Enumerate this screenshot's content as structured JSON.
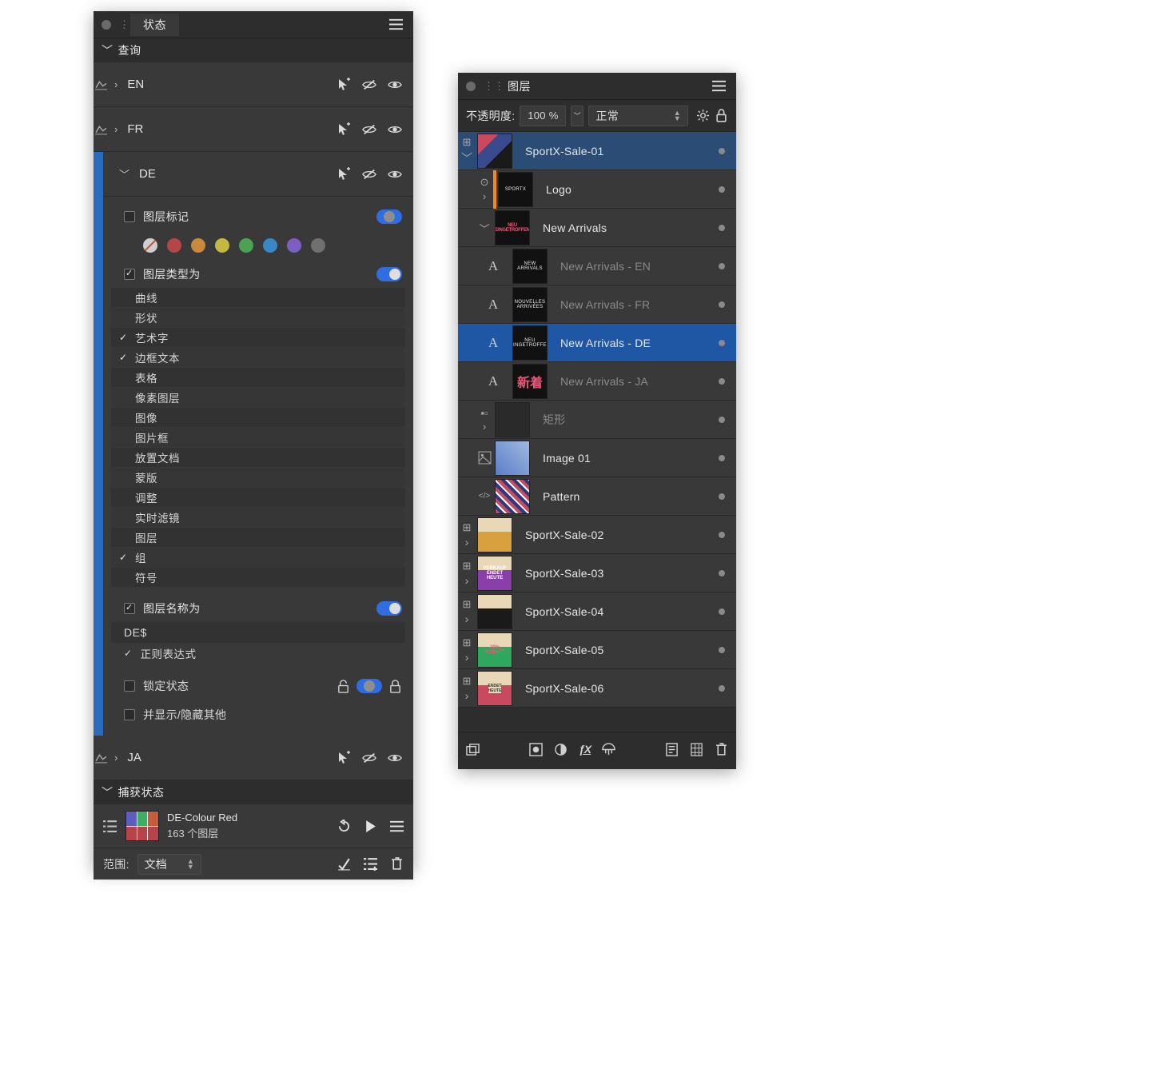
{
  "states": {
    "title": "状态",
    "query_label": "查询",
    "rows": [
      {
        "name": "EN",
        "expanded": false
      },
      {
        "name": "FR",
        "expanded": false
      },
      {
        "name": "DE",
        "expanded": true
      },
      {
        "name": "JA",
        "expanded": false
      }
    ],
    "de": {
      "layer_tag_label": "图层标记",
      "swatches": [
        "#b44646",
        "#c78a3c",
        "#c4b83e",
        "#4aa252",
        "#3a88c3",
        "#7a60c3",
        "#707070"
      ],
      "layer_type_label": "图层类型为",
      "types": [
        {
          "label": "曲线",
          "checked": false
        },
        {
          "label": "形状",
          "checked": false
        },
        {
          "label": "艺术字",
          "checked": true
        },
        {
          "label": "边框文本",
          "checked": true
        },
        {
          "label": "表格",
          "checked": false
        },
        {
          "label": "像素图层",
          "checked": false
        },
        {
          "label": "图像",
          "checked": false
        },
        {
          "label": "图片框",
          "checked": false
        },
        {
          "label": "放置文档",
          "checked": false
        },
        {
          "label": "蒙版",
          "checked": false
        },
        {
          "label": "调整",
          "checked": false
        },
        {
          "label": "实时滤镜",
          "checked": false
        },
        {
          "label": "图层",
          "checked": false
        },
        {
          "label": "组",
          "checked": true
        },
        {
          "label": "符号",
          "checked": false
        }
      ],
      "layer_name_label": "图层名称为",
      "name_value": "DE$",
      "regex_label": "正则表达式",
      "regex_checked": true,
      "lock_label": "锁定状态",
      "hide_others_label": "并显示/隐藏其他"
    },
    "captured_label": "捕获状态",
    "captured": {
      "name": "DE-Colour Red",
      "count": "163 个图层"
    },
    "footer": {
      "label": "范围:",
      "value": "文档"
    }
  },
  "layers": {
    "title": "图层",
    "opacity_label": "不透明度:",
    "opacity_value": "100 %",
    "blend_mode": "正常",
    "items": [
      {
        "kind": "artboard",
        "name": "SportX-Sale-01",
        "expanded": true,
        "sel": true,
        "thumb": "hero",
        "depth": 0
      },
      {
        "kind": "group",
        "name": "Logo",
        "depth": 1,
        "orange": true,
        "thumb_text": "SPORTX"
      },
      {
        "kind": "group",
        "name": "New Arrivals",
        "depth": 1,
        "expanded": true,
        "thumb_text": "NEU EINGETROFFEN",
        "thumbcolor": "#e85a7a"
      },
      {
        "kind": "text",
        "name": "New Arrivals - EN",
        "depth": 2,
        "thumb_text": "NEW ARRIVALS",
        "dim": true
      },
      {
        "kind": "text",
        "name": "New Arrivals - FR",
        "depth": 2,
        "thumb_text": "NOUVELLES ARRIVÉES",
        "dim": true
      },
      {
        "kind": "text",
        "name": "New Arrivals - DE",
        "depth": 2,
        "thumb_text": "NEU EINGETROFFEN",
        "sel": true
      },
      {
        "kind": "text",
        "name": "New Arrivals - JA",
        "depth": 2,
        "thumb_text": "新着",
        "ja": true,
        "dim": true
      },
      {
        "kind": "shape",
        "name": "矩形",
        "depth": 1,
        "dim": true,
        "empty": true
      },
      {
        "kind": "image",
        "name": "Image 01",
        "depth": 1,
        "thumb": "photo"
      },
      {
        "kind": "code",
        "name": "Pattern",
        "depth": 1,
        "thumb": "pattern"
      },
      {
        "kind": "artboard",
        "name": "SportX-Sale-02",
        "depth": 0,
        "thumb": "a2"
      },
      {
        "kind": "artboard",
        "name": "SportX-Sale-03",
        "depth": 0,
        "thumb": "a3"
      },
      {
        "kind": "artboard",
        "name": "SportX-Sale-04",
        "depth": 0,
        "thumb": "a4"
      },
      {
        "kind": "artboard",
        "name": "SportX-Sale-05",
        "depth": 0,
        "thumb": "a5"
      },
      {
        "kind": "artboard",
        "name": "SportX-Sale-06",
        "depth": 0,
        "thumb": "a6"
      }
    ]
  }
}
